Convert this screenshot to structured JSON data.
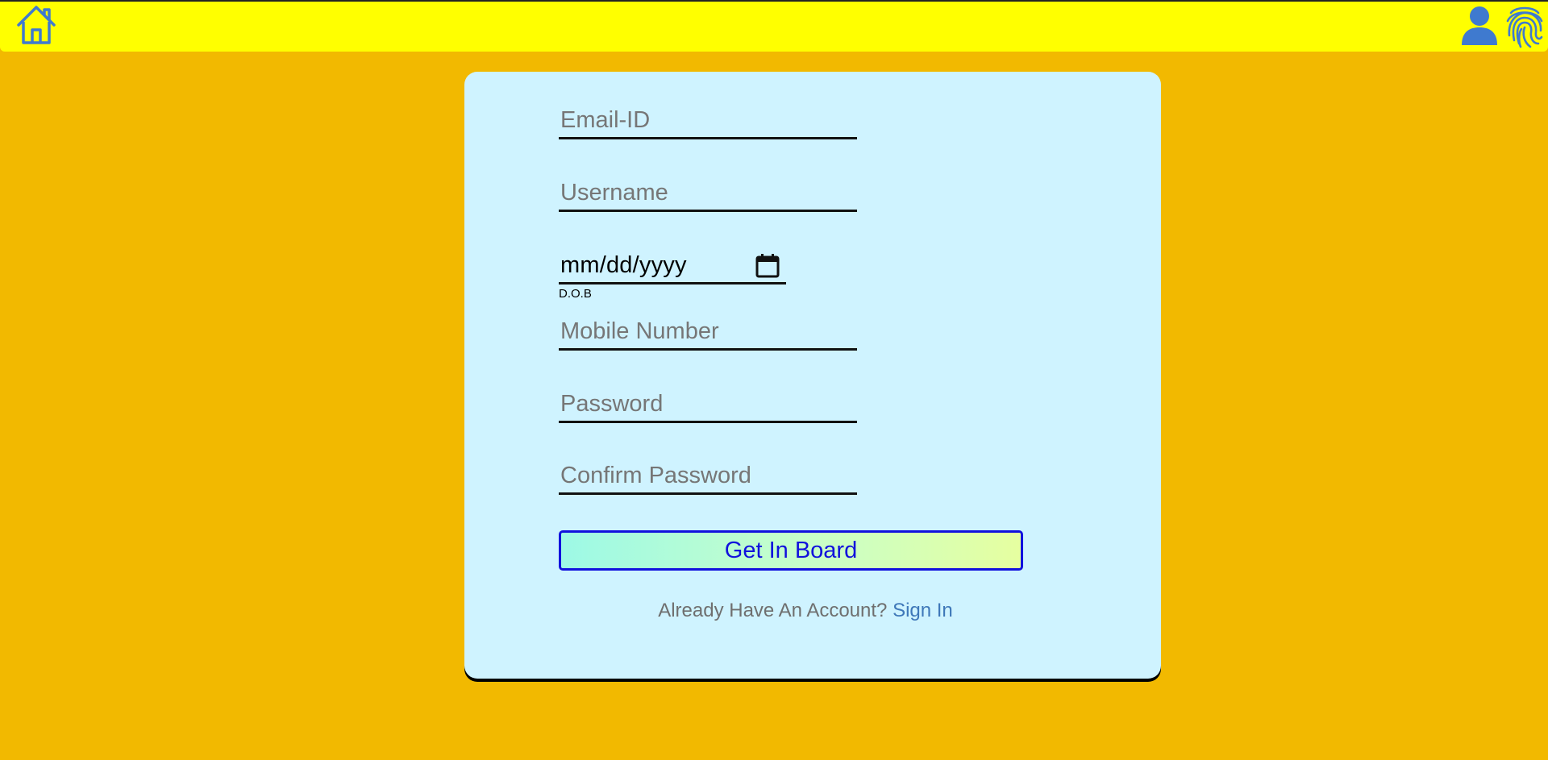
{
  "header": {
    "home_icon": "home-icon",
    "user_icon": "user-icon",
    "fingerprint_icon": "fingerprint-icon",
    "bar_color": "#FFFF00",
    "icon_color": "#3F7ACF"
  },
  "form": {
    "email": {
      "placeholder": "Email-ID",
      "value": ""
    },
    "username": {
      "placeholder": "Username",
      "value": ""
    },
    "dob": {
      "value": "mm/dd/yyyy",
      "label": "D.O.B",
      "icon": "calendar-icon"
    },
    "mobile": {
      "placeholder": "Mobile Number",
      "value": ""
    },
    "password": {
      "placeholder": "Password",
      "value": ""
    },
    "confirm_password": {
      "placeholder": "Confirm Password",
      "value": ""
    },
    "submit_label": "Get In Board",
    "account_prompt": "Already Have An Account?",
    "signin_label": "Sign In"
  },
  "colors": {
    "page_background": "#F2B900",
    "card_background": "#CFF3FF",
    "button_text": "#1111DD",
    "link": "#3F78B9"
  }
}
